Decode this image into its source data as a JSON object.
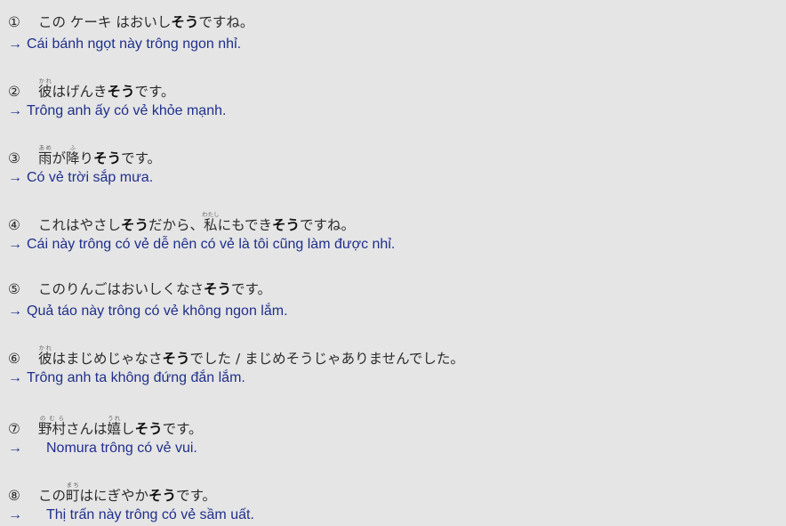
{
  "entries": [
    {
      "num": "①",
      "jp": [
        {
          "t": "この ケーキ はおいし"
        },
        {
          "t": "そう",
          "b": true
        },
        {
          "t": "ですね。"
        }
      ],
      "arrow": "→",
      "vi": "Cái bánh ngọt này trông ngon nhỉ."
    },
    {
      "num": "②",
      "jp": [
        {
          "t": "彼",
          "r": "かれ"
        },
        {
          "t": "はげんき"
        },
        {
          "t": "そう",
          "b": true
        },
        {
          "t": "です。"
        }
      ],
      "arrow": "→",
      "vi": "Trông anh ấy có vẻ khỏe mạnh."
    },
    {
      "num": "③",
      "jp": [
        {
          "t": "雨",
          "r": "あめ"
        },
        {
          "t": "が"
        },
        {
          "t": "降",
          "r": "ふ"
        },
        {
          "t": "り"
        },
        {
          "t": "そう",
          "b": true
        },
        {
          "t": "です。"
        }
      ],
      "arrow": "→",
      "vi": "Có vẻ trời sắp mưa."
    },
    {
      "num": "④",
      "jp": [
        {
          "t": "これはやさし"
        },
        {
          "t": "そう",
          "b": true
        },
        {
          "t": "だから、"
        },
        {
          "t": "私",
          "r": "わたし"
        },
        {
          "t": "にもでき"
        },
        {
          "t": "そう",
          "b": true
        },
        {
          "t": "ですね。"
        }
      ],
      "arrow": "→",
      "vi": "Cái này trông có vẻ dễ nên có vẻ là tôi cũng làm được nhỉ."
    },
    {
      "num": "⑤",
      "jp": [
        {
          "t": "このりんごはおいしくなさ"
        },
        {
          "t": "そう",
          "b": true
        },
        {
          "t": "です。"
        }
      ],
      "arrow": "→",
      "vi": "Quả táo này trông có vẻ không ngon lắm."
    },
    {
      "num": "⑥",
      "jp": [
        {
          "t": "彼",
          "r": "かれ"
        },
        {
          "t": "はまじめじゃなさ"
        },
        {
          "t": "そう",
          "b": true
        },
        {
          "t": "でした / まじめそうじゃありませんでした。"
        }
      ],
      "arrow": "→",
      "vi": "Trông anh ta không đứng đắn lắm."
    },
    {
      "num": "⑦",
      "jp": [
        {
          "t": "野村",
          "r": "のむら"
        },
        {
          "t": "さんは"
        },
        {
          "t": "嬉",
          "r": "うれ"
        },
        {
          "t": "し"
        },
        {
          "t": "そう",
          "b": true
        },
        {
          "t": "です。"
        }
      ],
      "arrow": "→",
      "vi": "Nomura trông có vẻ vui."
    },
    {
      "num": "⑧",
      "jp": [
        {
          "t": "この"
        },
        {
          "t": "町",
          "r": "まち"
        },
        {
          "t": "はにぎやか"
        },
        {
          "t": "そう",
          "b": true
        },
        {
          "t": "です。"
        }
      ],
      "arrow": "→",
      "vi": "Thị trấn này trông có vẻ sầm uất."
    }
  ]
}
